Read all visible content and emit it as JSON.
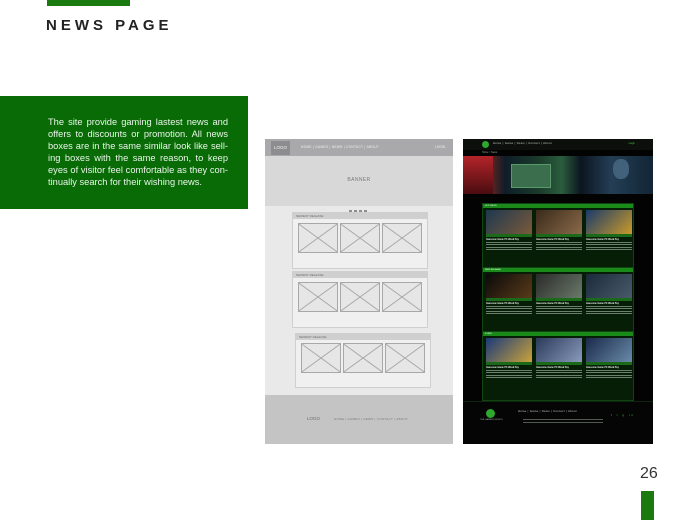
{
  "page": {
    "title": "NEWS PAGE",
    "description": "The site provide gaming lastest news and offers to discounts or promotion. All news boxes are in the same similar look like sell-ing boxes with the same reason, to keep eyes of visitor feel comfortable as they con-tinually search for their wishing news.",
    "page_number": "26",
    "accent_color": "#086b06"
  },
  "wireframe": {
    "nav": {
      "logo": "LOGO",
      "links": "HOME  |  GAMES  |  NEWS  |  CONTACT  |  ABOUT",
      "login": "LOGIN"
    },
    "banner": "BANNER",
    "sections": [
      "NEWEST RELEASE",
      "NEWEST RELEASE",
      "NEWEST RELEASE"
    ],
    "footer": {
      "logo": "LOGO",
      "links": "HOME  |  GAMES  |  NEWS  |  CONTACT  |  ABOUT"
    }
  },
  "design": {
    "nav": {
      "links": "Home  |  Game  |  News  |  Contact  |  About",
      "login": "Login"
    },
    "breadcrumb": "Home > News",
    "bands": [
      {
        "heading": "HOT NEWS",
        "cards": [
          "Awesome Game PC Week Pay",
          "Awesome Game PC Week Pay",
          "Awesome Game PC Week Pay"
        ]
      },
      {
        "heading": "NEW RELEASE",
        "cards": [
          "Awesome Game PC Week Pay",
          "Awesome Game PC Week Pay",
          "Awesome Game PC Week Pay"
        ]
      },
      {
        "heading": "EVENT",
        "cards": [
          "Awesome Game PC Week Pay",
          "Awesome Game PC Week Pay",
          "Awesome Game PC Week Pay"
        ]
      }
    ],
    "footer": {
      "logo_text": "THE GAMING WORLD",
      "links": "Home  |  Game  |  News  |  Contact  |  About",
      "social": "f  t  g  in"
    }
  }
}
